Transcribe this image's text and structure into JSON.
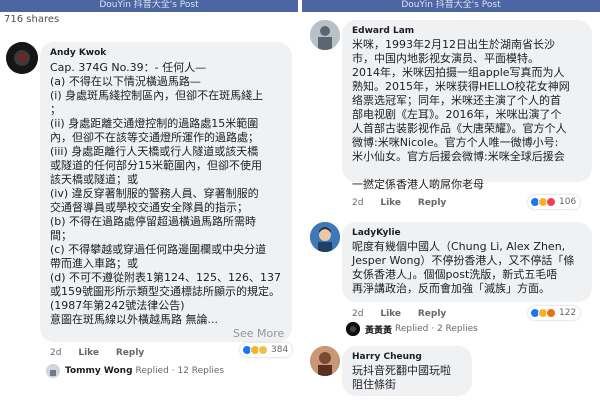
{
  "header": {
    "title": "DouYin 抖音大全's Post"
  },
  "left": {
    "shares": "716 shares",
    "comment": {
      "author": "Andy Kwok",
      "lines": [
        "Cap. 374G No.39：- 任何人—",
        "(a) 不得在以下情況橫過馬路—",
        "(i) 身處斑馬綫控制區內，但卻不在斑馬綫上",
        "；",
        "(ii) 身處距離交通燈控制的過路處15米範圍",
        "內，但卻不在該等交通燈所運作的過路處；",
        "(iii) 身處距離行人天橋或行人隧道或該天橋",
        "或隧道的任何部分15米範圍內，但卻不使用",
        "該天橋或隧道；或",
        "(iv) 違反穿著制服的警務人員、穿著制服的",
        "交通督導員或學校交通安全隊員的指示；",
        "(b) 不得在過路處停留超過橫過馬路所需時",
        "間；",
        "(c) 不得攀越或穿過任何路邊圍欄或中央分道",
        "帶而進入車路；或",
        "(d) 不可不遵從附表1第124、125、126、137",
        "或159號圖形所示類型交通標誌所顯示的規定。",
        "(1987年第242號法律公告)",
        "意圖在斑馬線以外橫越馬路 無論..."
      ],
      "see_more": "See More",
      "time": "2d",
      "like": "Like",
      "reply": "Reply",
      "react_count": "384",
      "reply_author": "Tommy Wong",
      "reply_text": "Replied · 12 Replies"
    }
  },
  "right": {
    "comments": [
      {
        "author": "Edward Lam",
        "lines": [
          "米咪，1993年2月12日出生於湖南省长沙",
          "市，中国内地影视女演员、平面模特。",
          "2014年，米咪因拍摄一组apple写真而为人",
          "熟知。2015年，米咪获得HELLO校花女神网",
          "络票选冠军；同年，米咪还主演了个人的首",
          "部电视剧《左耳》。2016年，米咪出演了个",
          "人首部古装影视作品《大唐荣耀》。官方个人",
          "微博:米咪Nicole。官方个人唯一微博小号:",
          "米小仙女。官方后援会微博:米咪全球后援会",
          "",
          "一撚定係香港人啲屌你老母"
        ],
        "time": "2d",
        "like": "Like",
        "reply": "Reply",
        "react_count": "106"
      },
      {
        "author": "LadyKylie",
        "lines": [
          "呢度有幾個中國人（Chung Li, Alex Zhen,",
          "Jesper Wong）不停扮香港人，又不停話「條",
          "女係香港人」。個個post洗版，新式五毛唔",
          "再淨講政治，反而會加強「滅族」方面。"
        ],
        "time": "2d",
        "like": "Like",
        "reply": "Reply",
        "react_count": "122",
        "reply_author": "黃黃黃",
        "reply_text": "Replied · 2 Replies"
      },
      {
        "author": "Harry Cheung",
        "lines": [
          "玩抖音死翻中國玩啦",
          "阻住條街"
        ]
      }
    ]
  }
}
